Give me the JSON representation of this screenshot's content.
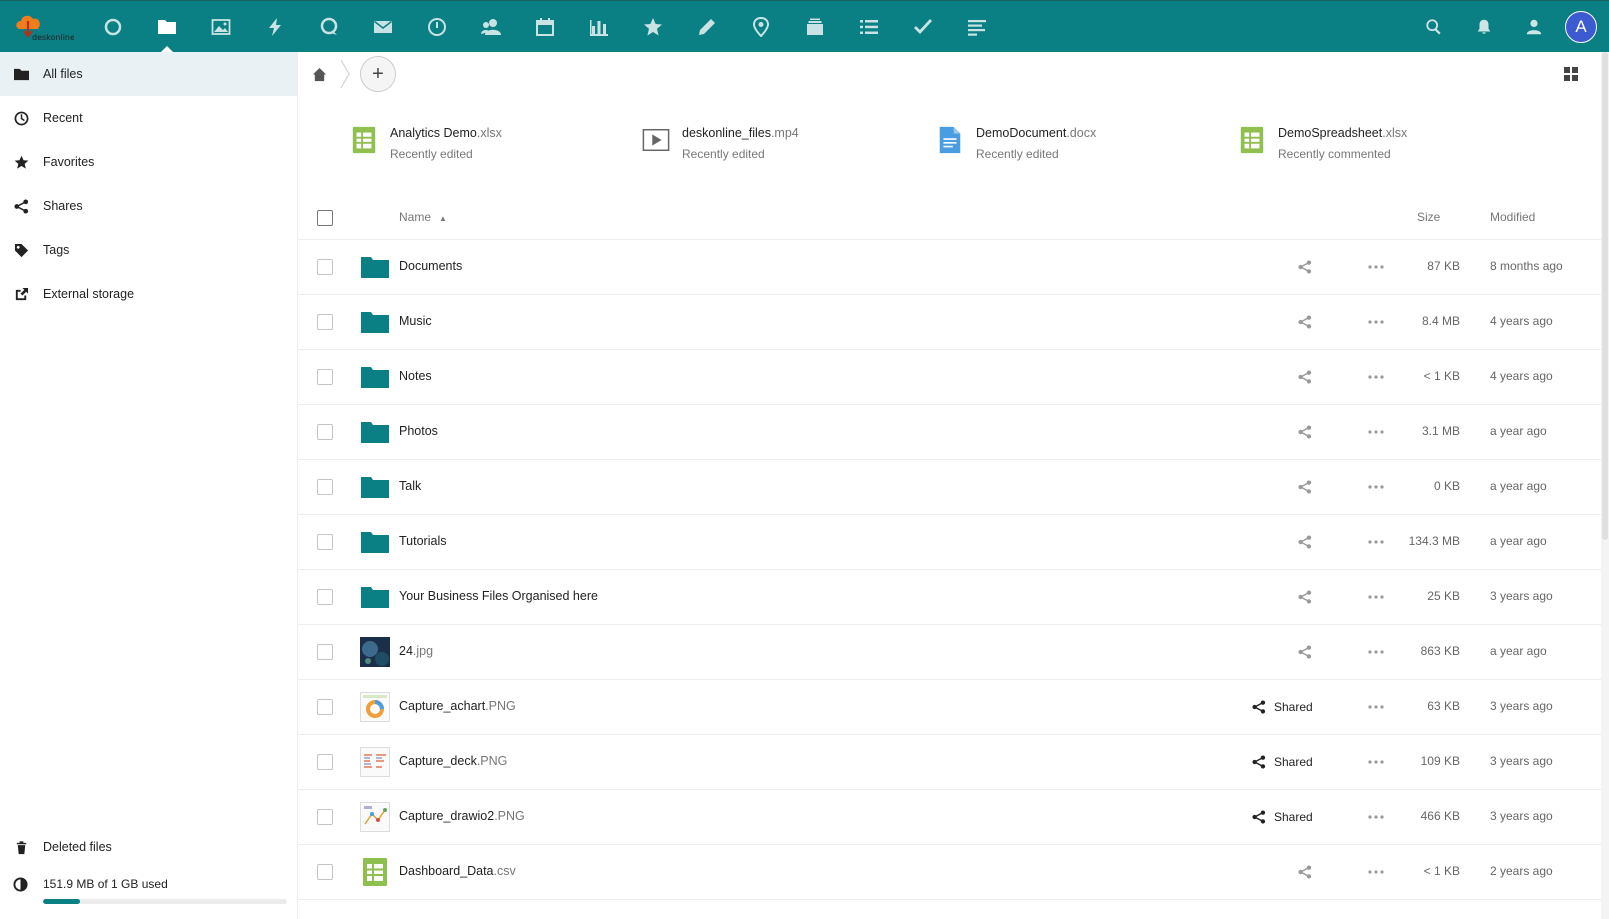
{
  "app": {
    "logo_text": "deskonline",
    "accent": "#0a7f84",
    "avatar_letter": "A"
  },
  "header": {
    "apps": [
      {
        "name": "dashboard-icon",
        "active": false
      },
      {
        "name": "files-icon",
        "active": true
      },
      {
        "name": "photos-icon",
        "active": false
      },
      {
        "name": "activity-icon",
        "active": false
      },
      {
        "name": "talk-icon",
        "active": false
      },
      {
        "name": "mail-icon",
        "active": false
      },
      {
        "name": "timer-icon",
        "active": false
      },
      {
        "name": "contacts-icon",
        "active": false
      },
      {
        "name": "calendar-icon",
        "active": false
      },
      {
        "name": "analytics-icon",
        "active": false
      },
      {
        "name": "bookmarks-icon",
        "active": false
      },
      {
        "name": "notes-icon",
        "active": false
      },
      {
        "name": "maps-icon",
        "active": false
      },
      {
        "name": "deck-icon",
        "active": false
      },
      {
        "name": "checklist-icon",
        "active": false
      },
      {
        "name": "tasks-icon",
        "active": false
      },
      {
        "name": "text-icon",
        "active": false
      }
    ]
  },
  "sidebar": {
    "items": [
      {
        "label": "All files",
        "icon": "folder-icon"
      },
      {
        "label": "Recent",
        "icon": "clock-icon"
      },
      {
        "label": "Favorites",
        "icon": "star-icon"
      },
      {
        "label": "Shares",
        "icon": "share-icon"
      },
      {
        "label": "Tags",
        "icon": "tag-icon"
      },
      {
        "label": "External storage",
        "icon": "external-icon"
      }
    ],
    "deleted_label": "Deleted files",
    "quota_label": "151.9 MB of 1 GB used",
    "quota_fraction": 0.152
  },
  "recent": [
    {
      "name": "Analytics Demo",
      "ext": ".xlsx",
      "sub": "Recently edited",
      "type": "spreadsheet"
    },
    {
      "name": "deskonline_files",
      "ext": ".mp4",
      "sub": "Recently edited",
      "type": "video"
    },
    {
      "name": "DemoDocument",
      "ext": ".docx",
      "sub": "Recently edited",
      "type": "document"
    },
    {
      "name": "DemoSpreadsheet",
      "ext": ".xlsx",
      "sub": "Recently commented",
      "type": "spreadsheet"
    }
  ],
  "table": {
    "col_name": "Name",
    "col_size": "Size",
    "col_modified": "Modified",
    "rows": [
      {
        "name": "Documents",
        "ext": "",
        "type": "folder",
        "shared": "",
        "size": "87 KB",
        "modified": "8 months ago"
      },
      {
        "name": "Music",
        "ext": "",
        "type": "folder",
        "shared": "",
        "size": "8.4 MB",
        "modified": "4 years ago"
      },
      {
        "name": "Notes",
        "ext": "",
        "type": "folder",
        "shared": "",
        "size": "< 1 KB",
        "modified": "4 years ago"
      },
      {
        "name": "Photos",
        "ext": "",
        "type": "folder",
        "shared": "",
        "size": "3.1 MB",
        "modified": "a year ago"
      },
      {
        "name": "Talk",
        "ext": "",
        "type": "folder",
        "shared": "",
        "size": "0 KB",
        "modified": "a year ago"
      },
      {
        "name": "Tutorials",
        "ext": "",
        "type": "folder",
        "shared": "",
        "size": "134.3 MB",
        "modified": "a year ago"
      },
      {
        "name": "Your Business Files Organised here",
        "ext": "",
        "type": "folder",
        "shared": "",
        "size": "25 KB",
        "modified": "3 years ago"
      },
      {
        "name": "24",
        "ext": ".jpg",
        "type": "image-dark",
        "shared": "",
        "size": "863 KB",
        "modified": "a year ago"
      },
      {
        "name": "Capture_achart",
        "ext": ".PNG",
        "type": "image-chart",
        "shared": "Shared",
        "size": "63 KB",
        "modified": "3 years ago"
      },
      {
        "name": "Capture_deck",
        "ext": ".PNG",
        "type": "image-deck",
        "shared": "Shared",
        "size": "109 KB",
        "modified": "3 years ago"
      },
      {
        "name": "Capture_drawio2",
        "ext": ".PNG",
        "type": "image-drawio",
        "shared": "Shared",
        "size": "466 KB",
        "modified": "3 years ago"
      },
      {
        "name": "Dashboard_Data",
        "ext": ".csv",
        "type": "spreadsheet",
        "shared": "",
        "size": "< 1 KB",
        "modified": "2 years ago"
      }
    ]
  }
}
